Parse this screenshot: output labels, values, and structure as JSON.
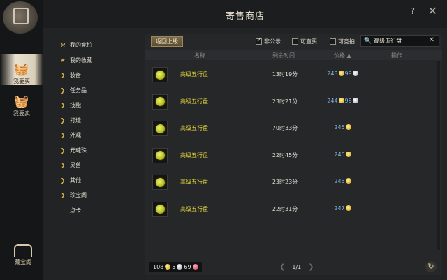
{
  "window": {
    "title": "寄售商店",
    "help": "?",
    "close": "✕"
  },
  "side_tabs": [
    {
      "label": "我要买",
      "active": true
    },
    {
      "label": "我要卖",
      "active": false
    }
  ],
  "bottom_logo": "藏宝阁",
  "categories": [
    {
      "label": "我的竞拍",
      "icon": "hammer-icon"
    },
    {
      "label": "我的收藏",
      "icon": "star-icon"
    },
    {
      "label": "装备",
      "icon": "chevron-right-icon"
    },
    {
      "label": "任务品",
      "icon": "chevron-right-icon"
    },
    {
      "label": "技能",
      "icon": "chevron-right-icon"
    },
    {
      "label": "打造",
      "icon": "chevron-right-icon"
    },
    {
      "label": "外观",
      "icon": "chevron-right-icon"
    },
    {
      "label": "元魂珠",
      "icon": "chevron-right-icon"
    },
    {
      "label": "灵兽",
      "icon": "chevron-right-icon"
    },
    {
      "label": "其他",
      "icon": "chevron-right-icon"
    },
    {
      "label": "珍宝阁",
      "icon": "chevron-right-icon"
    },
    {
      "label": "点卡",
      "icon": ""
    }
  ],
  "toolbar": {
    "back_label": "返回上级",
    "filters": [
      {
        "label": "非公示",
        "checked": true
      },
      {
        "label": "可直买",
        "checked": false
      },
      {
        "label": "可竞拍",
        "checked": false
      }
    ],
    "search_value": "高级五行盘"
  },
  "columns": {
    "name": "名称",
    "time": "剩余时间",
    "price": "价格 ▲",
    "action": "操作"
  },
  "items": [
    {
      "name": "高级五行盘",
      "time": "13时19分",
      "gold": "243",
      "silver": "99"
    },
    {
      "name": "高级五行盘",
      "time": "23时21分",
      "gold": "244",
      "silver": "98"
    },
    {
      "name": "高级五行盘",
      "time": "70时33分",
      "gold": "245",
      "silver": ""
    },
    {
      "name": "高级五行盘",
      "time": "22时45分",
      "gold": "245",
      "silver": ""
    },
    {
      "name": "高级五行盘",
      "time": "23时23分",
      "gold": "245",
      "silver": ""
    },
    {
      "name": "高级五行盘",
      "time": "22时31分",
      "gold": "247",
      "silver": ""
    }
  ],
  "footer": {
    "gold": "108",
    "silver": "5",
    "bound_silver": "69",
    "page": "1/1"
  }
}
